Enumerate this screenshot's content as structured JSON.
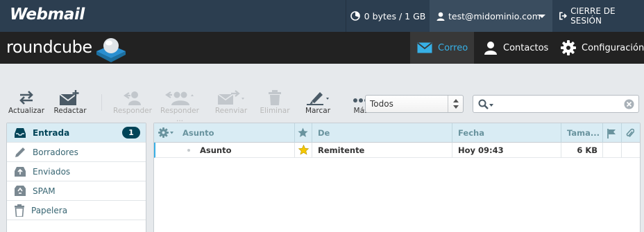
{
  "topbar": {
    "brand": "Webmail",
    "quota": "0 bytes / 1 GB",
    "user": "test@midominio.com",
    "logout": "CIERRE DE SESIÓN"
  },
  "navbar": {
    "logo": "roundcube",
    "tabs": [
      {
        "label": "Correo",
        "icon": "envelope-icon",
        "active": true
      },
      {
        "label": "Contactos",
        "icon": "person-icon"
      },
      {
        "label": "Configuración",
        "icon": "gear-icon"
      }
    ]
  },
  "toolbar": {
    "refresh": "Actualizar",
    "compose": "Redactar",
    "reply": "Responder",
    "reply_all": "Responder ...",
    "forward": "Reenviar",
    "delete": "Eliminar",
    "mark": "Marcar",
    "more": "Más",
    "filter_value": "Todos",
    "search_value": ""
  },
  "folders": [
    {
      "label": "Entrada",
      "icon": "inbox-icon",
      "active": true,
      "unread": "1"
    },
    {
      "label": "Borradores",
      "icon": "pencil-icon"
    },
    {
      "label": "Enviados",
      "icon": "sent-icon"
    },
    {
      "label": "SPAM",
      "icon": "recycle-icon"
    },
    {
      "label": "Papelera",
      "icon": "trash-icon"
    }
  ],
  "message_list": {
    "columns": {
      "subject": "Asunto",
      "from": "De",
      "date": "Fecha",
      "size": "Tama..."
    },
    "rows": [
      {
        "subject": "Asunto",
        "from": "Remitente",
        "date": "Hoy 09:43",
        "size": "6 KB",
        "flagged_star": true
      }
    ]
  },
  "colors": {
    "topbar_bg": "#2c3e50",
    "navbar_bg": "#222222",
    "accent": "#37b0e6",
    "header_row_bg": "#d9ecf4",
    "badge_bg": "#004458",
    "star": "#f5c800"
  }
}
